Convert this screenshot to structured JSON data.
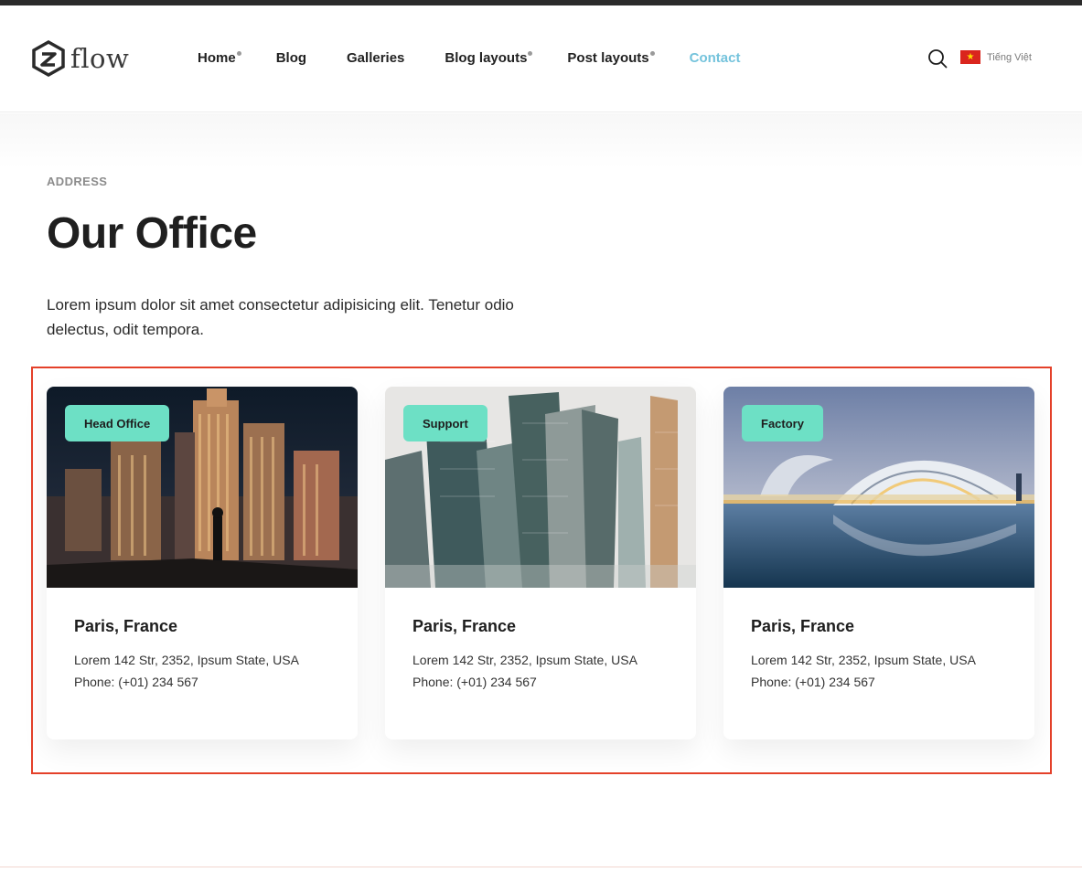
{
  "header": {
    "logo_text": "flow",
    "nav": [
      {
        "label": "Home",
        "dot": true,
        "active": false
      },
      {
        "label": "Blog",
        "dot": false,
        "active": false
      },
      {
        "label": "Galleries",
        "dot": false,
        "active": false
      },
      {
        "label": "Blog layouts",
        "dot": true,
        "active": false
      },
      {
        "label": "Post layouts",
        "dot": true,
        "active": false
      },
      {
        "label": "Contact",
        "dot": false,
        "active": true
      }
    ],
    "search_icon": "search-icon",
    "language_label": "Tiếng Việt",
    "language_flag": "vietnam-flag-icon"
  },
  "section": {
    "eyebrow": "ADDRESS",
    "title": "Our Office",
    "lead": "Lorem ipsum dolor sit amet consectetur adipisicing elit. Tenetur odio delectus, odit tempora."
  },
  "cards": [
    {
      "badge": "Head Office",
      "city": "Paris, France",
      "address": "Lorem 142 Str, 2352, Ipsum State, USA",
      "phone": "Phone: (+01) 234 567"
    },
    {
      "badge": "Support",
      "city": "Paris, France",
      "address": "Lorem 142 Str, 2352, Ipsum State, USA",
      "phone": "Phone: (+01) 234 567"
    },
    {
      "badge": "Factory",
      "city": "Paris, France",
      "address": "Lorem 142 Str, 2352, Ipsum State, USA",
      "phone": "Phone: (+01) 234 567"
    }
  ],
  "colors": {
    "accent_nav": "#74c3dc",
    "badge_bg": "#6de0c5",
    "highlight_border": "#e4412a"
  }
}
